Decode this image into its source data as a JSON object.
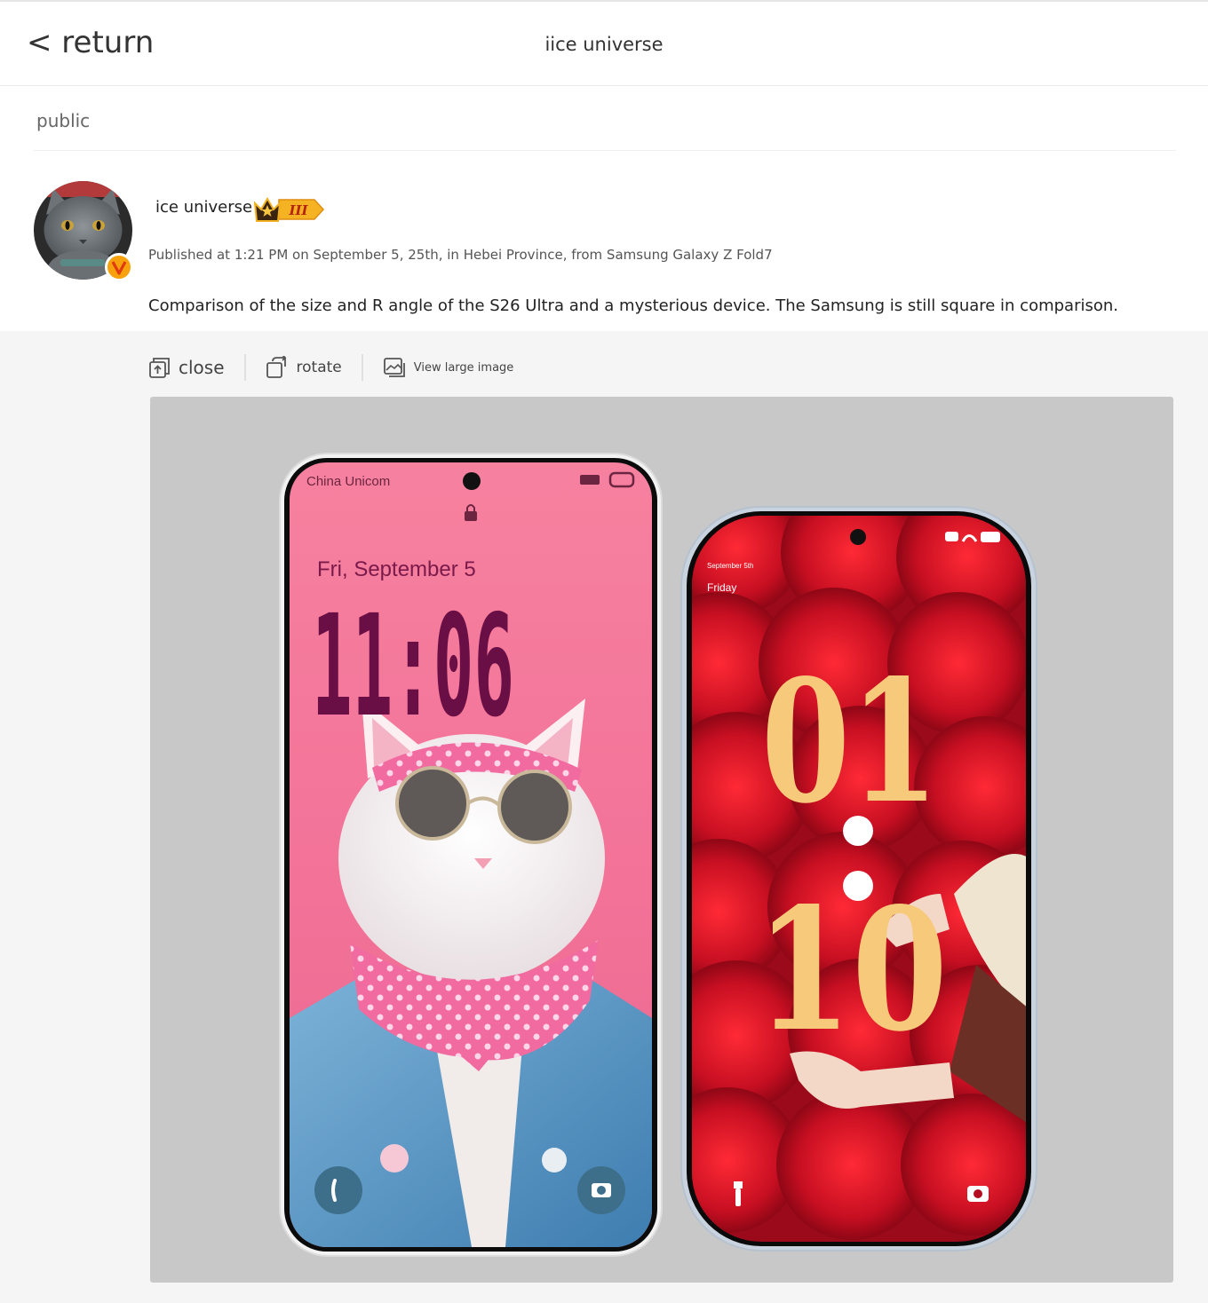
{
  "header": {
    "back_label": "< return",
    "title": "iice universe"
  },
  "post": {
    "visibility": "public",
    "author_name": "ice universe",
    "verified_badge": "V",
    "level_badge": "III",
    "meta": "Published at 1:21 PM on September 5, 25th, in Hebei Province, from Samsung Galaxy Z Fold7",
    "text": "Comparison of the size and R angle of the S26 Ultra and a mysterious device. The Samsung is still square in comparison."
  },
  "toolbar": {
    "close_label": "close",
    "rotate_label": "rotate",
    "large_label": "View large image"
  },
  "image": {
    "left_phone": {
      "carrier": "China Unicom",
      "date": "Fri, September 5",
      "time": "11:06"
    },
    "right_phone": {
      "date_small": "September 5th",
      "weekday": "Friday",
      "hour": "01",
      "minute": "10"
    }
  },
  "colors": {
    "accent_badge": "#f7a20c",
    "left_screen": "#f27d9f",
    "clock_purple": "#6a0f45",
    "right_screen": "#c8102e",
    "clock_gold": "#f7c97a"
  }
}
